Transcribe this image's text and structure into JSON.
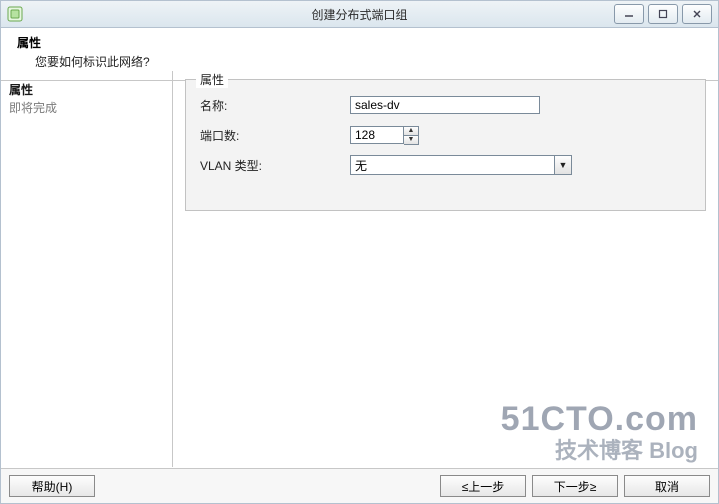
{
  "window": {
    "title": "创建分布式端口组"
  },
  "header": {
    "title": "属性",
    "subtitle": "您要如何标识此网络?"
  },
  "sidebar": {
    "items": [
      {
        "label": "属性",
        "current": true
      },
      {
        "label": "即将完成",
        "current": false
      }
    ]
  },
  "form": {
    "legend": "属性",
    "name_label": "名称:",
    "name_value": "sales-dv",
    "ports_label": "端口数:",
    "ports_value": "128",
    "vlan_type_label": "VLAN 类型:",
    "vlan_type_value": "无"
  },
  "footer": {
    "help": "帮助(H)",
    "back": "≤上一步",
    "next": "下一步≥",
    "cancel": "取消"
  },
  "watermark": {
    "line1": "51CTO.com",
    "line2": "技术博客 Blog"
  }
}
